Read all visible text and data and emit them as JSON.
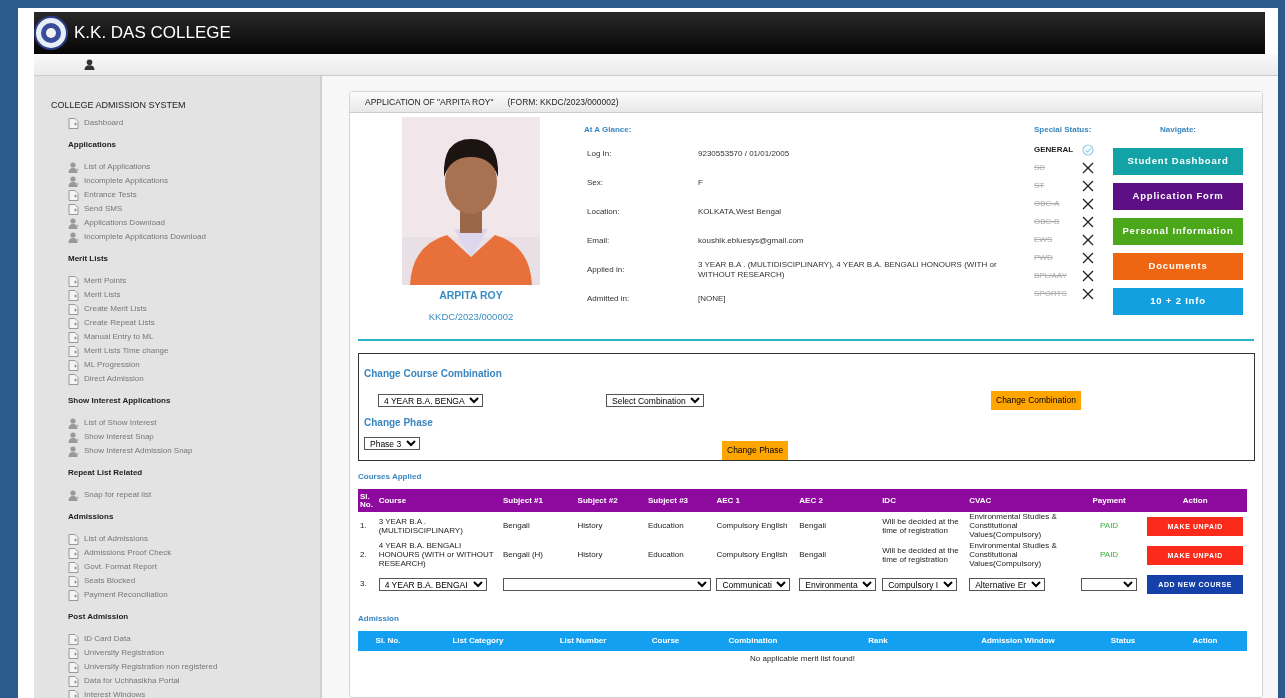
{
  "header": {
    "title": "K.K. DAS COLLEGE"
  },
  "sidebar": {
    "title": "COLLEGE ADMISSION SYSTEM",
    "top_items": [
      {
        "label": "Dashboard",
        "kind": "page"
      }
    ],
    "sections": [
      {
        "heading": "Applications",
        "items": [
          {
            "label": "List of Applications",
            "kind": "person"
          },
          {
            "label": "Incomplete Applications",
            "kind": "person"
          },
          {
            "label": "Entrance Tests",
            "kind": "page"
          },
          {
            "label": "Send SMS",
            "kind": "page"
          },
          {
            "label": "Applications Download",
            "kind": "person"
          },
          {
            "label": "Incomplete Applications Download",
            "kind": "person"
          }
        ]
      },
      {
        "heading": "Merit Lists",
        "items": [
          {
            "label": "Merit Points",
            "kind": "page"
          },
          {
            "label": "Merit Lists",
            "kind": "page"
          },
          {
            "label": "Create Merit Lists",
            "kind": "page"
          },
          {
            "label": "Create Repeat Lists",
            "kind": "page"
          },
          {
            "label": "Manual Entry to ML",
            "kind": "page"
          },
          {
            "label": "Merit Lists Time change",
            "kind": "page"
          },
          {
            "label": "ML Progression",
            "kind": "page"
          },
          {
            "label": "Direct Admission",
            "kind": "page"
          }
        ]
      },
      {
        "heading": "Show Interest Applications",
        "items": [
          {
            "label": "List of Show Interest",
            "kind": "person"
          },
          {
            "label": "Show Interest Snap",
            "kind": "person"
          },
          {
            "label": "Show Interest Admission Snap",
            "kind": "person"
          }
        ]
      },
      {
        "heading": "Repeat List Related",
        "items": [
          {
            "label": "Snap for repeat list",
            "kind": "person"
          }
        ]
      },
      {
        "heading": "Admissions",
        "items": [
          {
            "label": "List of Admissions",
            "kind": "page"
          },
          {
            "label": "Admissions Proof Check",
            "kind": "page"
          },
          {
            "label": "Govt. Format Report",
            "kind": "page"
          },
          {
            "label": "Seats Blocked",
            "kind": "page"
          },
          {
            "label": "Payment Reconciliation",
            "kind": "page"
          }
        ]
      },
      {
        "heading": "Post Admission",
        "items": [
          {
            "label": "ID Card Data",
            "kind": "page"
          },
          {
            "label": "University Registration",
            "kind": "page"
          },
          {
            "label": "University Registration non registered",
            "kind": "page"
          },
          {
            "label": "Data for Uchhasikha Portal",
            "kind": "page"
          },
          {
            "label": "Interest Windows",
            "kind": "page"
          }
        ]
      }
    ]
  },
  "panel": {
    "title": "APPLICATION OF \"ARPITA ROY\"",
    "form": "(FORM: KKDC/2023/000002)"
  },
  "profile": {
    "name": "ARPITA ROY",
    "form_no": "KKDC/2023/000002"
  },
  "glance": {
    "heading": "At A Glance:",
    "fields": [
      {
        "label": "Log In:",
        "value": "9230553570 / 01/01/2005"
      },
      {
        "label": "Sex:",
        "value": "F"
      },
      {
        "label": "Location:",
        "value": "KOLKATA,West Bengal"
      },
      {
        "label": "Email:",
        "value": "koushik.ebluesys@gmail.com"
      },
      {
        "label": "Applied in:",
        "value": "3 YEAR B.A . (MULTIDISCIPLINARY), 4 YEAR B.A. BENGALI HONOURS (WITH or WITHOUT RESEARCH)"
      },
      {
        "label": "Admitted in:",
        "value": "[NONE]"
      }
    ]
  },
  "special_status": {
    "heading": "Special Status:",
    "items": [
      {
        "label": "GENERAL",
        "active": true
      },
      {
        "label": "SC",
        "active": false
      },
      {
        "label": "ST",
        "active": false
      },
      {
        "label": "OBC-A",
        "active": false
      },
      {
        "label": "OBC-B",
        "active": false
      },
      {
        "label": "EWS",
        "active": false
      },
      {
        "label": "PWD",
        "active": false
      },
      {
        "label": "BPL/AAY",
        "active": false
      },
      {
        "label": "SPORTS",
        "active": false
      }
    ]
  },
  "navigate": {
    "heading": "Navigate:",
    "buttons": [
      {
        "label": "Student Dashboard",
        "color": "#13a3a6"
      },
      {
        "label": "Application Form",
        "color": "#5e0f85"
      },
      {
        "label": "Personal Information",
        "color": "#4aa81a"
      },
      {
        "label": "Documents",
        "color": "#ee6611"
      },
      {
        "label": "10 + 2 Info",
        "color": "#12a0e0"
      }
    ]
  },
  "change_combination": {
    "heading": "Change Course Combination",
    "course": "4 YEAR B.A. BENGA",
    "combination": "Select Combination",
    "button": "Change Combination"
  },
  "change_phase": {
    "heading": "Change Phase",
    "phase": "Phase 3",
    "button": "Change Phase"
  },
  "courses_applied": {
    "heading": "Courses Applied",
    "columns": [
      "Sl. No.",
      "Course",
      "Subject #1",
      "Subject #2",
      "Subject #3",
      "AEC 1",
      "AEC 2",
      "IDC",
      "CVAC",
      "Payment",
      "Action"
    ],
    "rows": [
      {
        "sl": "1.",
        "course": "3 YEAR B.A . (MULTIDISCIPLINARY)",
        "subject_1": "Bengali",
        "subject_2": "History",
        "subject_3": "Education",
        "aec_1": "Compulsory English",
        "aec_2": "Bengali",
        "idc": "Will be decided at the time of registration",
        "cvac": "Environmental Studies & Constitutional Values(Compulsory)",
        "payment": "PAID",
        "action": "MAKE UNPAID"
      },
      {
        "sl": "2.",
        "course": "4 YEAR B.A. BENGALI HONOURS (WITH or WITHOUT RESEARCH)",
        "subject_1": "Bengali (H)",
        "subject_2": "History",
        "subject_3": "Education",
        "aec_1": "Compulsory English",
        "aec_2": "Bengali",
        "idc": "Will be decided at the time of registration",
        "cvac": "Environmental Studies & Constitutional Values(Compulsory)",
        "payment": "PAID",
        "action": "MAKE UNPAID"
      }
    ],
    "new_row": {
      "sl": "3.",
      "course": "4 YEAR B.A. BENGAI",
      "aec_1": "Communicati",
      "aec_2": "Environmenta",
      "idc": "Compulsory I",
      "cvac": "Alternative Er",
      "action": "ADD NEW COURSE"
    }
  },
  "admission": {
    "heading": "Admission",
    "columns": [
      "Sl. No.",
      "List Category",
      "List Number",
      "Course",
      "Combination",
      "Rank",
      "Admission Window",
      "Status",
      "Action"
    ],
    "empty_message": "No applicable merit list found!"
  }
}
